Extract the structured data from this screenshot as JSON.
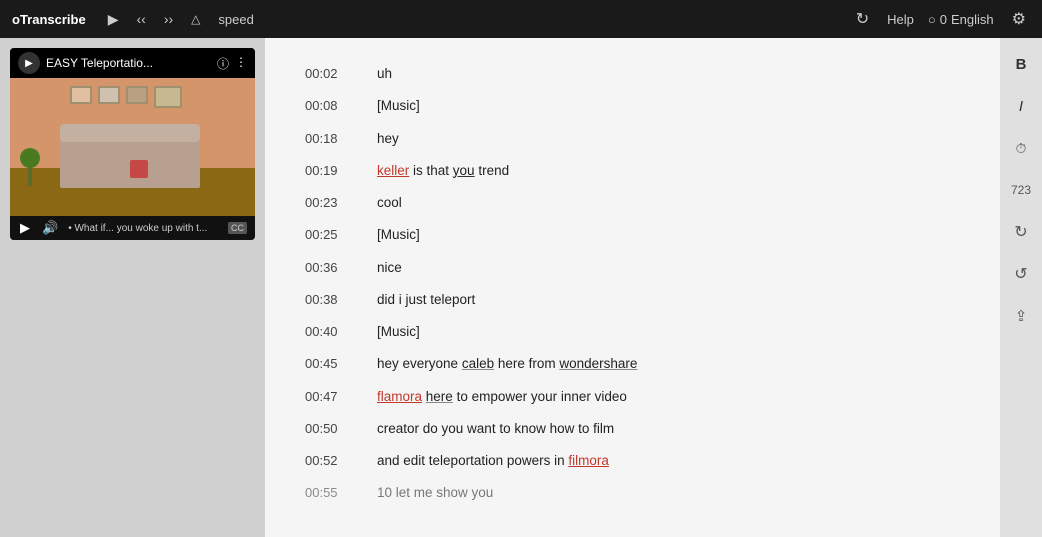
{
  "nav": {
    "brand": "oTranscribe",
    "speed_label": "speed",
    "help_label": "Help",
    "language_label": "English",
    "language_count": "0"
  },
  "video": {
    "title": "EASY Teleportatio...",
    "subtitle_text": "• What if... you woke up with t...",
    "info_icon": "ℹ",
    "more_icon": "⋮"
  },
  "transcript": {
    "rows": [
      {
        "time": "00:02",
        "text": "uh",
        "markup": "plain"
      },
      {
        "time": "00:08",
        "text": "[Music]",
        "markup": "plain"
      },
      {
        "time": "00:18",
        "text": "hey",
        "markup": "plain"
      },
      {
        "time": "00:19",
        "text": "keller is that you trend",
        "markup": "keller-you"
      },
      {
        "time": "00:23",
        "text": "cool",
        "markup": "plain"
      },
      {
        "time": "00:25",
        "text": "[Music]",
        "markup": "plain"
      },
      {
        "time": "00:36",
        "text": "nice",
        "markup": "plain"
      },
      {
        "time": "00:38",
        "text": "did i just teleport",
        "markup": "plain"
      },
      {
        "time": "00:40",
        "text": "[Music]",
        "markup": "plain"
      },
      {
        "time": "00:45",
        "text": "hey everyone caleb here from wondershare",
        "markup": "caleb-wondershare"
      },
      {
        "time": "00:47",
        "text": "flamora here to empower your inner video",
        "markup": "flamora-here"
      },
      {
        "time": "00:50",
        "text": "creator do you want to know how to film",
        "markup": "plain"
      },
      {
        "time": "00:52",
        "text": "and edit teleportation powers in filmora",
        "markup": "filmora"
      },
      {
        "time": "00:55",
        "text": "10 let me show you",
        "markup": "plain"
      }
    ]
  },
  "sidebar": {
    "bold_label": "B",
    "italic_label": "I",
    "word_count": "723"
  }
}
